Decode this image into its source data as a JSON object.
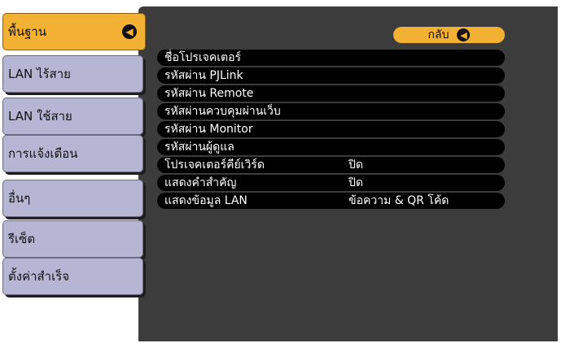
{
  "sidebar": {
    "items": [
      {
        "label": "พื้นฐาน",
        "active": true
      },
      {
        "label": "LAN ไร้สาย"
      },
      {
        "label": "LAN ใช้สาย"
      },
      {
        "label": "การแจ้งเตือน"
      },
      {
        "label": "อื่นๆ"
      },
      {
        "label": "รีเซ็ต"
      },
      {
        "label": "ตั้งค่าสำเร็จ"
      }
    ]
  },
  "header": {
    "back_label": "กลับ"
  },
  "menu": {
    "items": [
      {
        "label": "ชื่อโปรเจคเตอร์",
        "value": ""
      },
      {
        "label": "รหัสผ่าน PJLink",
        "value": ""
      },
      {
        "label": "รหัสผ่าน Remote",
        "value": ""
      },
      {
        "label": "รหัสผ่านควบคุมผ่านเว็บ",
        "value": ""
      },
      {
        "label": "รหัสผ่าน Monitor",
        "value": ""
      },
      {
        "label": "รหัสผ่านผู้ดูแล",
        "value": ""
      },
      {
        "label": "โปรเจคเตอร์คีย์เวิร์ด",
        "value": "ปิด"
      },
      {
        "label": "แสดงคำสำคัญ",
        "value": "ปิด"
      },
      {
        "label": "แสดงข้อมูล LAN",
        "value": "ข้อความ & QR โค้ด"
      }
    ]
  },
  "colors": {
    "accent": "#f3b133",
    "sidebar": "#b6b6d4",
    "panel": "#3c3c3c"
  }
}
